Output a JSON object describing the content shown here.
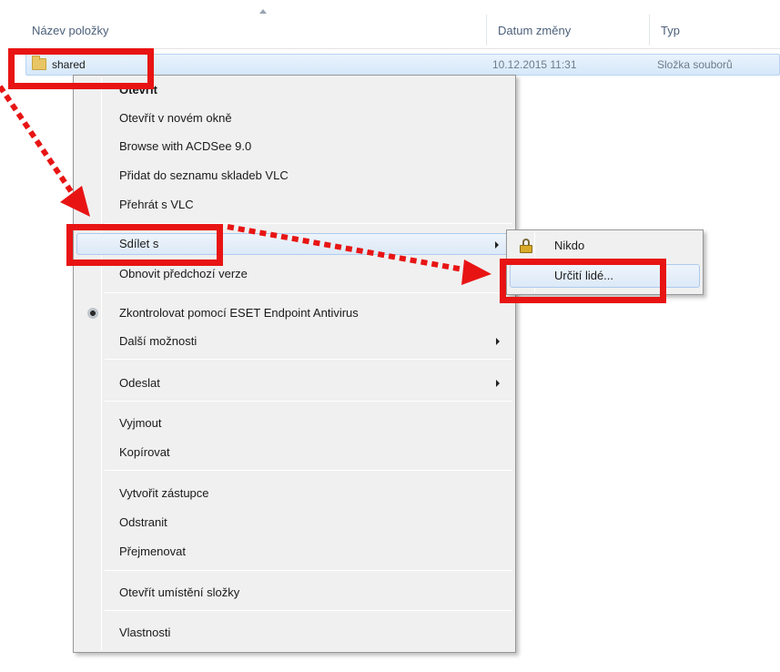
{
  "header": {
    "col_name": "Název položky",
    "col_date": "Datum změny",
    "col_type": "Typ"
  },
  "file": {
    "name": "shared",
    "date": "10.12.2015 11:31",
    "type": "Složka souborů",
    "icon": "folder-icon"
  },
  "menu": {
    "open": "Otevřít",
    "open_new_window": "Otevřít v novém okně",
    "acdsee": "Browse with ACDSee 9.0",
    "vlc_add": "Přidat do seznamu skladeb VLC",
    "vlc_play": "Přehrát s VLC",
    "share_with": "Sdílet s",
    "restore_versions": "Obnovit předchozí verze",
    "eset_scan": "Zkontrolovat pomocí ESET Endpoint Antivirus",
    "more_options": "Další možnosti",
    "send_to": "Odeslat",
    "cut": "Vyjmout",
    "copy": "Kopírovat",
    "create_shortcut": "Vytvořit zástupce",
    "delete": "Odstranit",
    "rename": "Přejmenovat",
    "open_location": "Otevřít umístění složky",
    "properties": "Vlastnosti"
  },
  "submenu": {
    "nobody": "Nikdo",
    "specific_people": "Určití lidé..."
  },
  "colors": {
    "annotation_red": "#e81414",
    "menu_bg": "#f0f0f0",
    "selection_border": "#aecbed"
  }
}
